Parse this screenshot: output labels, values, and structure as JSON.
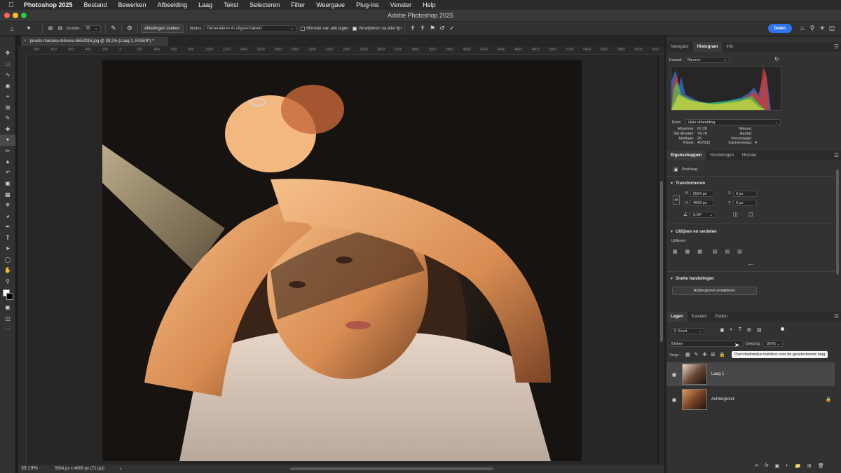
{
  "menubar": {
    "items": [
      "Photoshop 2025",
      "Bestand",
      "Bewerken",
      "Afbeelding",
      "Laag",
      "Tekst",
      "Selecteren",
      "Filter",
      "Weergave",
      "Plug-ins",
      "Venster",
      "Help"
    ]
  },
  "window": {
    "title": "Adobe Photoshop 2025"
  },
  "options": {
    "size_label": "Grootte:",
    "size_value": "35",
    "find_distractions": "Afleidingen zoeken",
    "mode_label": "Modus",
    "mode_value": "Generatieve AI uitgeschakeld",
    "sample_all_layers": "Monster van alle lagen",
    "remove_after_stroke": "Verwijderen na elke lijn",
    "share_label": "Delen"
  },
  "document": {
    "tab_title": "pexels-mariana-mileeva-6652916.jpg @ 39,2% (Laag 1, RGB/8*) *",
    "zoom": "39,19%",
    "dimensions": "5584 px x 4669 px (72 ppi)"
  },
  "ruler_h": [
    "900",
    "800",
    "600",
    "400",
    "200",
    "0",
    "200",
    "400",
    "600",
    "800",
    "1000",
    "1200",
    "1400",
    "1600",
    "1800",
    "2000",
    "2200",
    "2400",
    "2600",
    "2800",
    "3000",
    "3200",
    "3400",
    "3600",
    "3800",
    "4000",
    "4200",
    "4400",
    "4600",
    "4800",
    "5000",
    "5200",
    "5400",
    "5600",
    "5800",
    "6000",
    "6200",
    "6400"
  ],
  "histogram_panel": {
    "tabs": [
      "Navigator",
      "Histogram",
      "Info"
    ],
    "channel_label": "Kanaal:",
    "channel_value": "Kleuren",
    "source_label": "Bron:",
    "source_value": "Hele afbeelding",
    "stats_left": [
      {
        "label": "Moyenne:",
        "value": "67,05"
      },
      {
        "label": "Std.deviatie:",
        "value": "74,78"
      },
      {
        "label": "Mediaan:",
        "value": "25"
      },
      {
        "label": "Pixels:",
        "value": "407632"
      }
    ],
    "stats_right": [
      {
        "label": "Niveau:",
        "value": ""
      },
      {
        "label": "Aantal:",
        "value": ""
      },
      {
        "label": "Percentage:",
        "value": ""
      },
      {
        "label": "Cacheniveau:",
        "value": "4"
      }
    ]
  },
  "properties_panel": {
    "tabs": [
      "Eigenschappen",
      "Handelingen",
      "Historie"
    ],
    "layer_type": "Pixellaag",
    "transform_title": "Transformeren",
    "w_label": "B",
    "w_value": "5584 px",
    "h_label": "H",
    "h_value": "4669 px",
    "x_label": "X",
    "x_value": "0 px",
    "y_label": "Y",
    "y_value": "0 px",
    "angle_value": "0,00°",
    "align_title": "Uitlijnen en verdelen",
    "align_label": "Uitlijnen:",
    "quick_title": "Snelle handelingen",
    "remove_bg": "Achtergrond verwijderen"
  },
  "layers_panel": {
    "tabs": [
      "Lagen",
      "Kanalen",
      "Paden"
    ],
    "filter_kind": "Soort",
    "blend_mode": "Bleken",
    "opacity_label": "Dekking:",
    "opacity_value": "100%",
    "lock_label": "Vergr.:",
    "tooltip": "Overvloeimodus instellen voor de geselecteerde laag",
    "layers": [
      {
        "name": "Laag 1",
        "selected": true,
        "locked": false
      },
      {
        "name": "Achtergrond",
        "selected": false,
        "locked": true
      }
    ]
  },
  "colors": {
    "accent": "#2f75f0",
    "traffic_red": "#fe5f57",
    "traffic_yellow": "#febc2e",
    "traffic_green": "#28c840"
  }
}
